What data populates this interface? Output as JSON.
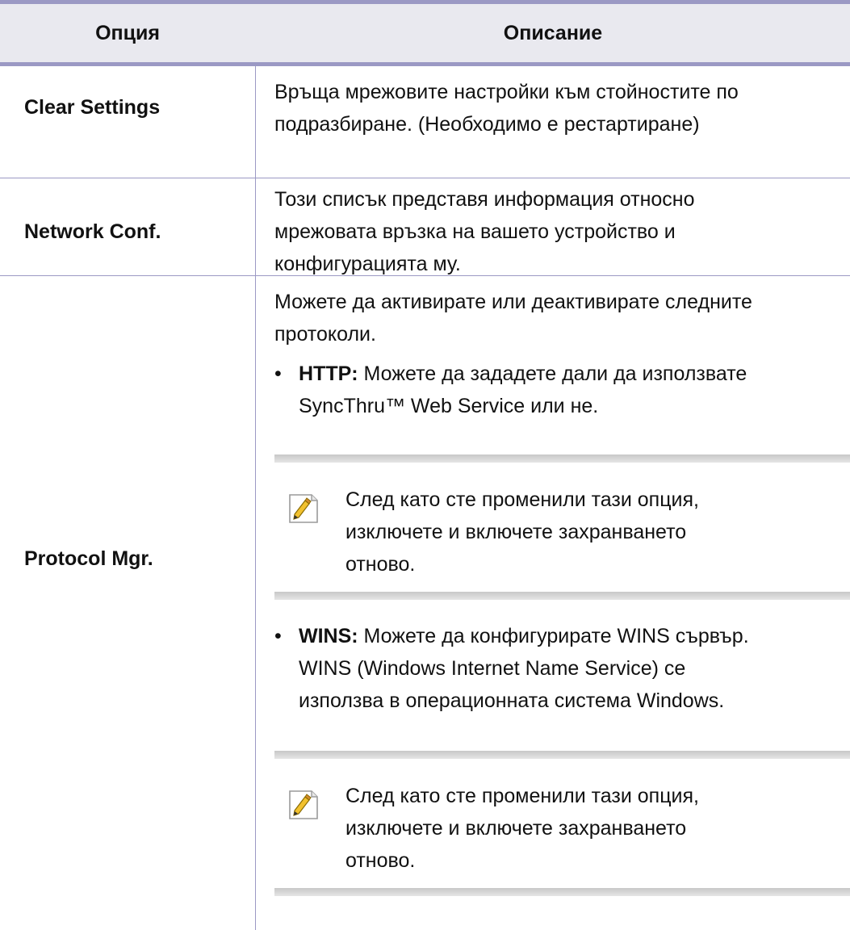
{
  "table": {
    "headers": {
      "option": "Опция",
      "description": "Описание"
    },
    "rows": [
      {
        "option": "Clear Settings",
        "description": [
          "Връща мрежовите настройки към стойностите по",
          "подразбиране. (Необходимо е рестартиране)"
        ]
      },
      {
        "option": "Network Conf.",
        "description": [
          "Този списък представя информация относно",
          "мрежовата връзка на вашето устройство и",
          "конфигурацията му."
        ]
      },
      {
        "option": "Protocol Mgr.",
        "intro": [
          "Можете да активирате или деактивирате следните",
          "протоколи."
        ],
        "bullets": [
          {
            "marker": "•",
            "label": "HTTP:",
            "lines": [
              " Можете да зададете дали да използвате",
              "SyncThru™ Web Service или не."
            ]
          },
          {
            "marker": "•",
            "label": "WINS:",
            "lines": [
              " Можете да конфигурирате WINS сървър.",
              "WINS (Windows Internet Name Service) се",
              "използва в операционната система Windows."
            ]
          }
        ],
        "notes": [
          {
            "icon": "note-pencil-icon",
            "lines": [
              "След като сте променили тази опция,",
              "изключете и включете захранването",
              "отново."
            ]
          },
          {
            "icon": "note-pencil-icon",
            "lines": [
              "След като сте променили тази опция,",
              "изключете и включете захранването",
              "отново."
            ]
          }
        ]
      }
    ]
  },
  "colors": {
    "rule": "#9b99c4",
    "header_bg": "#e9e9ef",
    "note_band": "#cfcfcf",
    "note_icon_accent": "#f1c40f"
  }
}
